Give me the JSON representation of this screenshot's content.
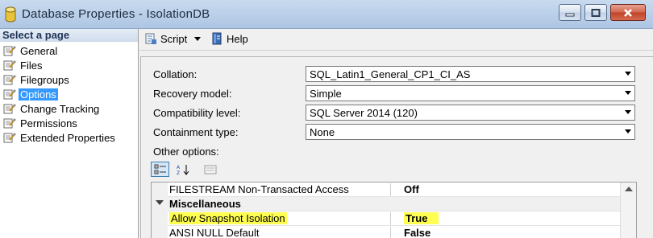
{
  "window": {
    "title": "Database Properties - IsolationDB"
  },
  "sidebar": {
    "header": "Select a page",
    "items": [
      {
        "label": "General"
      },
      {
        "label": "Files"
      },
      {
        "label": "Filegroups"
      },
      {
        "label": "Options",
        "selected": true
      },
      {
        "label": "Change Tracking"
      },
      {
        "label": "Permissions"
      },
      {
        "label": "Extended Properties"
      }
    ]
  },
  "toolbar": {
    "script_label": "Script",
    "help_label": "Help"
  },
  "form": {
    "collation": {
      "label": "Collation:",
      "value": "SQL_Latin1_General_CP1_CI_AS"
    },
    "recovery": {
      "label": "Recovery model:",
      "value": "Simple"
    },
    "compat": {
      "label": "Compatibility level:",
      "value": "SQL Server 2014 (120)"
    },
    "containment": {
      "label": "Containment type:",
      "value": "None"
    },
    "other_options_label": "Other options:"
  },
  "grid": {
    "rows": [
      {
        "name": "FILESTREAM Non-Transacted Access",
        "value": "Off"
      },
      {
        "name": "Miscellaneous",
        "category": true
      },
      {
        "name": "Allow Snapshot Isolation",
        "value": "True",
        "highlighted": true
      },
      {
        "name": "ANSI NULL Default",
        "value": "False"
      }
    ]
  },
  "colors": {
    "selection": "#3399ff",
    "highlight": "#ffff52"
  },
  "icons": {
    "app": "database-cylinder-icon",
    "page": "wrench-page-icon",
    "script": "script-icon",
    "help": "help-book-icon"
  }
}
